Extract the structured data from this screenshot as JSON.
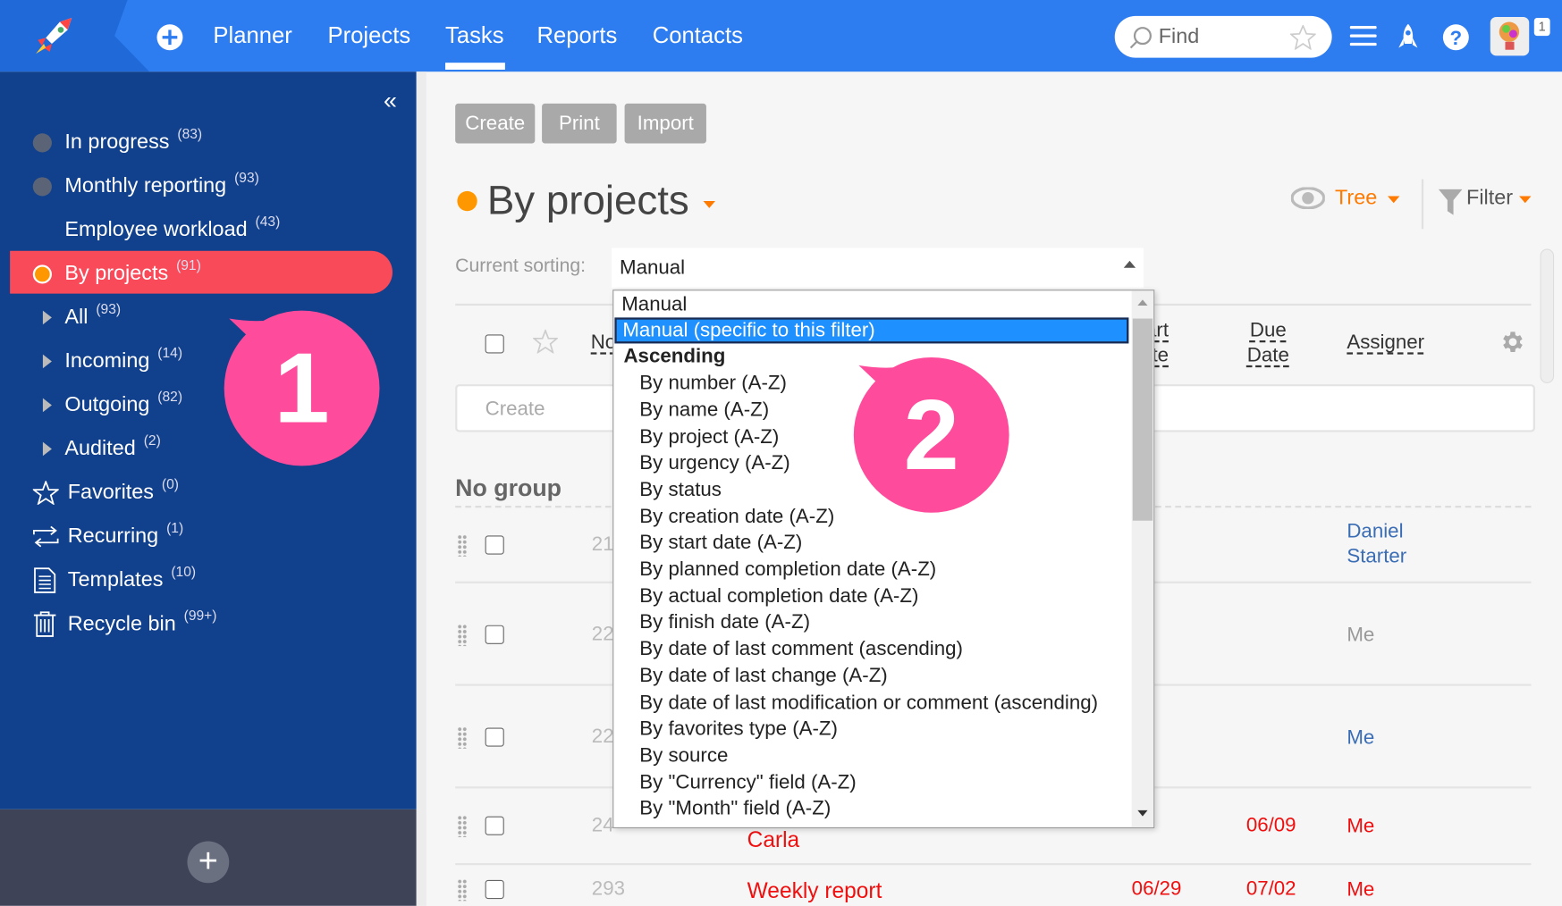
{
  "topbar": {
    "nav": [
      "Planner",
      "Projects",
      "Tasks",
      "Reports",
      "Contacts"
    ],
    "active_nav": "Tasks",
    "search_placeholder": "Find",
    "notification_count": "1",
    "brand_color": "#2d7cf0"
  },
  "sidebar": {
    "items": [
      {
        "label": "In progress",
        "count": "(83)",
        "icon": "gray-dot-icon"
      },
      {
        "label": "Monthly reporting",
        "count": "(93)",
        "icon": "gray-dot-icon"
      },
      {
        "label": "Employee workload",
        "count": "(43)",
        "icon": ""
      },
      {
        "label": "By projects",
        "count": "(91)",
        "icon": "orange-dot-icon",
        "active": true
      },
      {
        "label": "All",
        "count": "(93)",
        "icon": "expand-arrow-icon"
      },
      {
        "label": "Incoming",
        "count": "(14)",
        "icon": "expand-arrow-icon"
      },
      {
        "label": "Outgoing",
        "count": "(82)",
        "icon": "expand-arrow-icon"
      },
      {
        "label": "Audited",
        "count": "(2)",
        "icon": "expand-arrow-icon"
      },
      {
        "label": "Favorites",
        "count": "(0)",
        "icon": "star-icon"
      },
      {
        "label": "Recurring",
        "count": "(1)",
        "icon": "recurring-icon"
      },
      {
        "label": "Templates",
        "count": "(10)",
        "icon": "template-icon"
      },
      {
        "label": "Recycle bin",
        "count": "(99+)",
        "icon": "trash-icon"
      }
    ],
    "active_color": "#f94a5a"
  },
  "toolbar": {
    "create": "Create",
    "print": "Print",
    "import": "Import"
  },
  "page": {
    "title": "By projects",
    "view_label": "Tree",
    "filter_label": "Filter",
    "sorting_label": "Current sorting:",
    "sorting_value": "Manual"
  },
  "sort_dropdown": {
    "items": [
      {
        "label": "Manual",
        "type": "option"
      },
      {
        "label": "Manual (specific to this filter)",
        "type": "selected"
      },
      {
        "label": "Ascending",
        "type": "group"
      },
      {
        "label": "By number (A-Z)",
        "type": "sub"
      },
      {
        "label": "By name (A-Z)",
        "type": "sub"
      },
      {
        "label": "By project (A-Z)",
        "type": "sub"
      },
      {
        "label": "By urgency (A-Z)",
        "type": "sub"
      },
      {
        "label": "By status",
        "type": "sub"
      },
      {
        "label": "By creation date (A-Z)",
        "type": "sub"
      },
      {
        "label": "By start date (A-Z)",
        "type": "sub"
      },
      {
        "label": "By planned completion date (A-Z)",
        "type": "sub"
      },
      {
        "label": "By actual completion date (A-Z)",
        "type": "sub"
      },
      {
        "label": "By finish date (A-Z)",
        "type": "sub"
      },
      {
        "label": "By date of last comment (ascending)",
        "type": "sub"
      },
      {
        "label": "By date of last change (A-Z)",
        "type": "sub"
      },
      {
        "label": "By date of last modification or comment (ascending)",
        "type": "sub"
      },
      {
        "label": "By favorites type (A-Z)",
        "type": "sub"
      },
      {
        "label": "By source",
        "type": "sub"
      },
      {
        "label": "By \"Currency\" field (A-Z)",
        "type": "sub"
      },
      {
        "label": "By \"Month\" field (A-Z)",
        "type": "sub"
      }
    ]
  },
  "table": {
    "headers": {
      "number": "No",
      "start_date": "Start Date",
      "due_date": "Due Date",
      "assigner": "Assigner"
    },
    "create_placeholder": "Create",
    "group": "No group",
    "rows": [
      {
        "number": "21",
        "name": "",
        "start": "",
        "due": "",
        "assigner": "Daniel Starter",
        "color": "#3a6db5"
      },
      {
        "number": "22",
        "name": "",
        "start": "",
        "due": "",
        "assigner": "Me",
        "color": "#999999"
      },
      {
        "number": "22",
        "name": "",
        "start": "",
        "due": "",
        "assigner": "Me",
        "color": "#3a6db5"
      },
      {
        "number": "24",
        "name": "Carla",
        "start": "",
        "due": "06/09",
        "assigner": "Me",
        "color": "#f00f0f"
      },
      {
        "number": "293",
        "name": "Weekly report",
        "start": "06/29",
        "due": "07/02",
        "assigner": "Me",
        "color": "#f00f0f"
      }
    ]
  },
  "callouts": [
    "1",
    "2"
  ]
}
